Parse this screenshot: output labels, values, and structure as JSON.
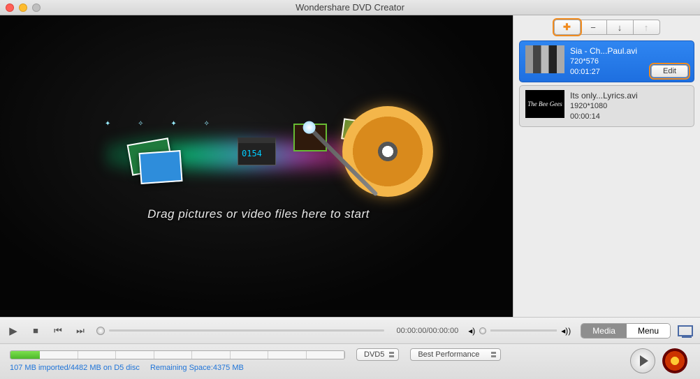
{
  "title": "Wondershare DVD Creator",
  "preview": {
    "drag_text": "Drag  pictures or video files here to start"
  },
  "toolbar": {
    "add": "✚",
    "remove": "−",
    "down": "↓",
    "up": "↑"
  },
  "media_items": [
    {
      "name": "Sia - Ch...Paul.avi",
      "res": "720*576",
      "dur": "00:01:27",
      "selected": true,
      "thumb_label": "",
      "edit_label": "Edit"
    },
    {
      "name": "Its only...Lyrics.avi",
      "res": "1920*1080",
      "dur": "00:00:14",
      "selected": false,
      "thumb_label": "The Bee Gees"
    }
  ],
  "playback": {
    "timecode": "00:00:00/00:00:00"
  },
  "tabs": {
    "media": "Media",
    "menu": "Menu"
  },
  "capacity": {
    "disc_type": "DVD5",
    "quality": "Best Performance",
    "imported": "107 MB imported/4482 MB on D5 disc",
    "remaining": "Remaining Space:4375 MB"
  }
}
